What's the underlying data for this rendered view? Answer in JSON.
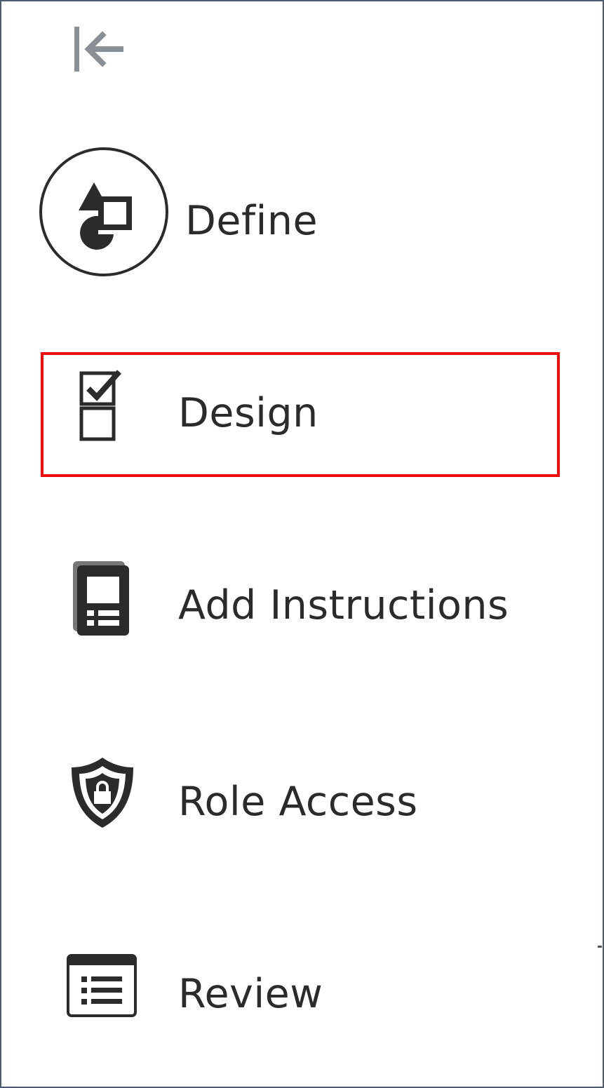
{
  "toolbar": {
    "collapse_icon": "collapse-left-icon"
  },
  "nav": {
    "items": [
      {
        "label": "Define",
        "icon": "shapes-icon",
        "selected": false
      },
      {
        "label": "Design",
        "icon": "checklist-icon",
        "selected": true
      },
      {
        "label": "Add Instructions",
        "icon": "instructions-icon",
        "selected": false
      },
      {
        "label": "Role Access",
        "icon": "shield-lock-icon",
        "selected": false
      },
      {
        "label": "Review",
        "icon": "review-list-icon",
        "selected": false
      }
    ]
  },
  "colors": {
    "border": "#4a5c73",
    "highlight": "#f00d0d",
    "text": "#2b2b2b",
    "icon": "#2b2b2b",
    "collapse_icon": "#8a8f95"
  }
}
